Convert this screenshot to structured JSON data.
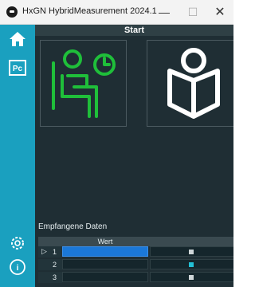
{
  "window": {
    "title": "HxGN HybridMeasurement 2024.1",
    "buttons": {
      "minimize": "—",
      "maximize": "☐",
      "close": "✕"
    }
  },
  "sidebar": {
    "top_items": [
      {
        "icon": "home-icon"
      },
      {
        "icon": "pc-icon",
        "label": "Pc"
      }
    ],
    "bottom_items": [
      {
        "icon": "gear-icon"
      },
      {
        "icon": "info-icon",
        "label": "i"
      }
    ]
  },
  "header": {
    "title": "Start"
  },
  "tiles": [
    {
      "icon": "person-waiting-clock-icon",
      "color": "#1fbf3a"
    },
    {
      "icon": "person-reading-book-icon",
      "color": "#ffffff"
    }
  ],
  "received": {
    "label": "Empfangene Daten",
    "column_header": "Wert",
    "rows": [
      {
        "num": "1",
        "marker": "▷",
        "selected": true
      },
      {
        "num": "2",
        "marker": "",
        "selected": false
      },
      {
        "num": "3",
        "marker": "",
        "selected": false
      }
    ]
  },
  "colors": {
    "accent": "#1aa0bf",
    "panel": "#1f2e34",
    "selection": "#1b78d8",
    "tile_icon": "#1fbf3a"
  }
}
